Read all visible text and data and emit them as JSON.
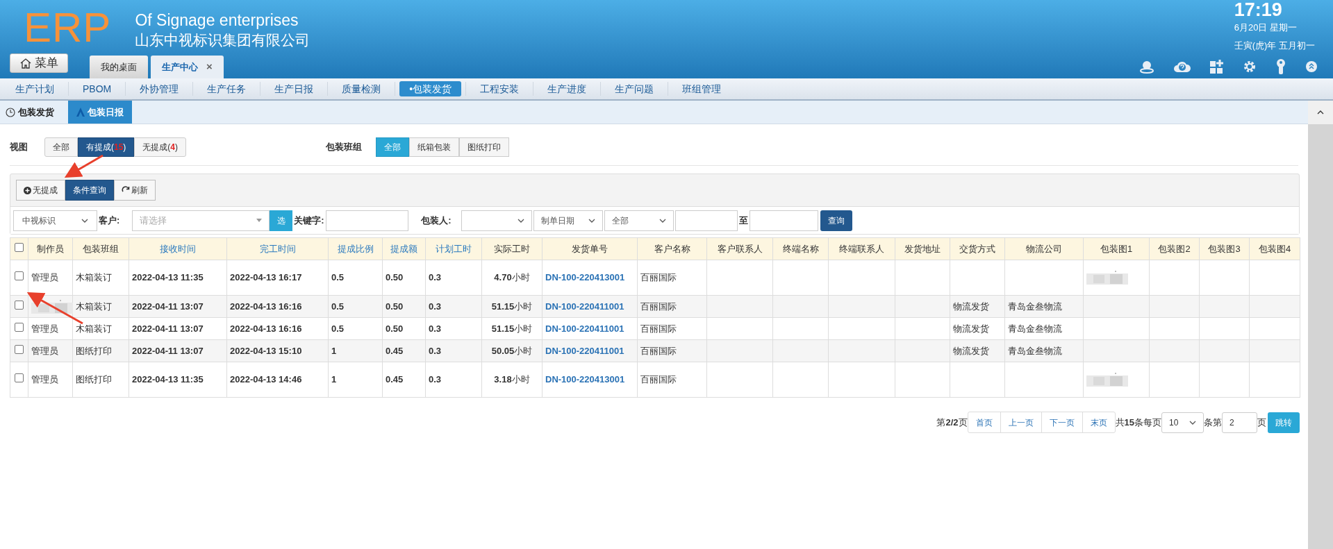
{
  "brand": {
    "logo": "ERP",
    "title_en": "Of Signage enterprises",
    "title_cn": "山东中视标识集团有限公司"
  },
  "clock": {
    "time": "17:19",
    "date": "6月20日 星期一",
    "lunar": "壬寅(虎)年 五月初一"
  },
  "menu_button": "菜单",
  "tabs": [
    {
      "label": "我的桌面",
      "selected": false
    },
    {
      "label": "生产中心",
      "selected": true,
      "close": "×"
    }
  ],
  "nav": [
    {
      "label": "生产计划",
      "selected": false
    },
    {
      "label": "PBOM",
      "selected": false
    },
    {
      "label": "外协管理",
      "selected": false
    },
    {
      "label": "生产任务",
      "selected": false
    },
    {
      "label": "生产日报",
      "selected": false
    },
    {
      "label": "质量检测",
      "selected": false
    },
    {
      "label": "•包装发货",
      "selected": true
    },
    {
      "label": "工程安装",
      "selected": false
    },
    {
      "label": "生产进度",
      "selected": false
    },
    {
      "label": "生产问题",
      "selected": false
    },
    {
      "label": "班组管理",
      "selected": false
    }
  ],
  "subtabs": [
    {
      "label": "包装发货",
      "selected": false
    },
    {
      "label": "包装日报",
      "selected": true
    }
  ],
  "view": {
    "label": "视图",
    "options": [
      {
        "label": "全部",
        "selected": false
      },
      {
        "label": "有提成(",
        "count": "15",
        "close": ")",
        "selected": true
      },
      {
        "label": "无提成(",
        "count": "4",
        "close": ")",
        "selected": false
      }
    ]
  },
  "group": {
    "label": "包装班组",
    "options": [
      {
        "label": "全部",
        "selected": true
      },
      {
        "label": "纸箱包装",
        "selected": false
      },
      {
        "label": "图纸打印",
        "selected": false
      }
    ]
  },
  "toolbar": [
    {
      "label": "无提成",
      "selected": false
    },
    {
      "label": "条件查询",
      "selected": true
    },
    {
      "label": "刷新",
      "selected": false
    }
  ],
  "filters": {
    "company": "中视标识",
    "customer_label": "客户:",
    "customer_placeholder": "请选择",
    "choose": "选",
    "keyword_label": "关键字:",
    "packer_label": "包装人:",
    "date_type": "制单日期",
    "range": "全部",
    "to": "至",
    "search": "查询"
  },
  "table": {
    "select_all": {
      "checked": false
    },
    "columns": [
      {
        "label": "制作员",
        "kind": "plain"
      },
      {
        "label": "包装班组",
        "kind": "plain"
      },
      {
        "label": "接收时间",
        "kind": "sortable"
      },
      {
        "label": "完工时间",
        "kind": "sortable"
      },
      {
        "label": "提成比例",
        "kind": "sortable"
      },
      {
        "label": "提成额",
        "kind": "sortable"
      },
      {
        "label": "计划工时",
        "kind": "sortable"
      },
      {
        "label": "实际工时",
        "kind": "plain"
      },
      {
        "label": "发货单号",
        "kind": "plain"
      },
      {
        "label": "客户名称",
        "kind": "plain"
      },
      {
        "label": "客户联系人",
        "kind": "plain"
      },
      {
        "label": "终端名称",
        "kind": "plain"
      },
      {
        "label": "终端联系人",
        "kind": "plain"
      },
      {
        "label": "发货地址",
        "kind": "plain"
      },
      {
        "label": "交货方式",
        "kind": "plain"
      },
      {
        "label": "物流公司",
        "kind": "plain"
      },
      {
        "label": "包装图1",
        "kind": "plain"
      },
      {
        "label": "包装图2",
        "kind": "plain"
      },
      {
        "label": "包装图3",
        "kind": "plain"
      },
      {
        "label": "包装图4",
        "kind": "plain"
      }
    ],
    "rows": [
      {
        "checked": false,
        "cells": [
          "管理员",
          "木箱装订",
          "2022-04-13 11:35",
          "2022-04-13 16:17",
          "0.5",
          "0.50",
          "0.3",
          "**4.70**小时",
          "DN-100-220413001",
          "百丽国际",
          null,
          null,
          null,
          null,
          null,
          null,
          {
            "kind": "blurred"
          },
          null,
          null,
          null
        ]
      },
      {
        "checked": false,
        "cells": [
          {
            "kind": "blurred"
          },
          "木箱装订",
          "2022-04-11 13:07",
          "2022-04-13 16:16",
          "0.5",
          "0.50",
          "0.3",
          "**51.15**小时",
          "DN-100-220411001",
          "百丽国际",
          null,
          null,
          null,
          null,
          "物流发货",
          "青岛金叁物流",
          null,
          null,
          null,
          null
        ]
      },
      {
        "checked": false,
        "cells": [
          "管理员",
          "木箱装订",
          "2022-04-11 13:07",
          "2022-04-13 16:16",
          "0.5",
          "0.50",
          "0.3",
          "**51.15**小时",
          "DN-100-220411001",
          "百丽国际",
          null,
          null,
          null,
          null,
          "物流发货",
          "青岛金叁物流",
          null,
          null,
          null,
          null
        ]
      },
      {
        "checked": false,
        "cells": [
          "管理员",
          "图纸打印",
          "2022-04-11 13:07",
          "2022-04-13 15:10",
          "1",
          "0.45",
          "0.3",
          "**50.05**小时",
          "DN-100-220411001",
          "百丽国际",
          null,
          null,
          null,
          null,
          "物流发货",
          "青岛金叁物流",
          null,
          null,
          null,
          null
        ]
      },
      {
        "checked": false,
        "cells": [
          "管理员",
          "图纸打印",
          "2022-04-13 11:35",
          "2022-04-13 14:46",
          "1",
          "0.45",
          "0.3",
          "**3.18**小时",
          "DN-100-220413001",
          "百丽国际",
          null,
          null,
          null,
          null,
          null,
          null,
          {
            "kind": "blurred"
          },
          null,
          null,
          null
        ]
      }
    ]
  },
  "pagination": {
    "page_info": "第**2/2**页",
    "buttons": [
      "首页",
      "上一页",
      "下一页",
      "末页"
    ],
    "total": "共**15**条每页",
    "page_size": "10",
    "goto_label": "条第",
    "goto_value": "2",
    "page_word": "页",
    "go": "跳转"
  }
}
